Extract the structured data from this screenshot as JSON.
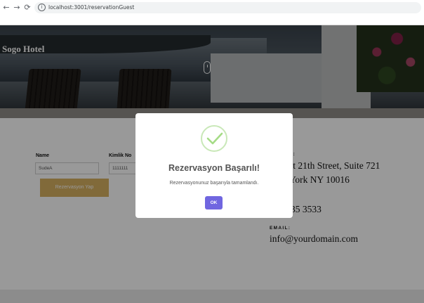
{
  "browser": {
    "url": "localhost:3001/reservationGuest",
    "back_glyph": "←",
    "forward_glyph": "→",
    "reload_glyph": "⟳",
    "info_glyph": "i"
  },
  "header": {
    "brand": "Sogo Hotel"
  },
  "form": {
    "name_label": "Name",
    "name_value": "SudeA",
    "id_label": "Kimlik No",
    "id_value": "1111111",
    "submit_label": "Rezervasyon Yap",
    "submit_color": "#d8b161"
  },
  "contact": {
    "address_label_partial": "S:",
    "address_line1_partial": "st 21th Street, Suite 721",
    "address_line2_partial": "York NY 10016",
    "phone_partial": "35 3533",
    "email_label": "EMAIL:",
    "email_value": "info@yourdomain.com"
  },
  "modal": {
    "title": "Rezervasyon Başarılı!",
    "message": "Rezervasyonunuz başarıyla tamamlandı.",
    "ok_label": "OK",
    "ok_color": "#7066e0",
    "success_color": "#a5dc86",
    "icon": "success-check-icon"
  }
}
